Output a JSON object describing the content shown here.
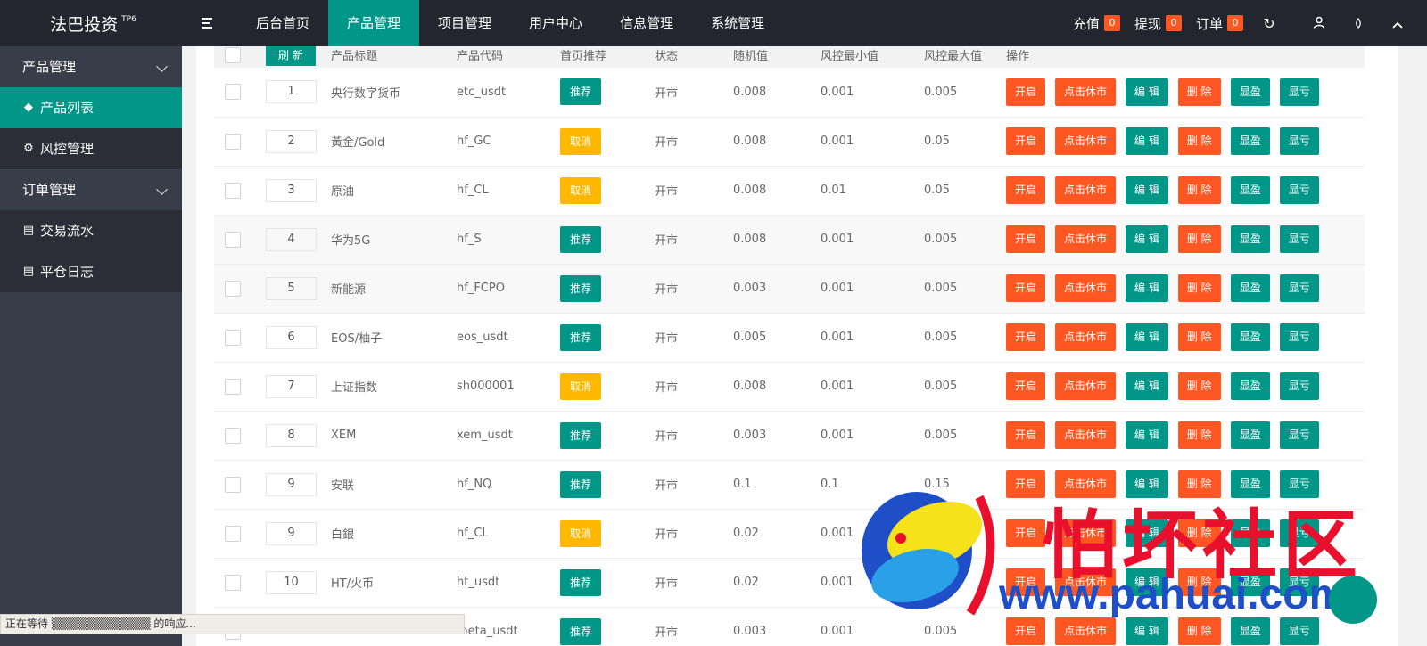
{
  "app": {
    "title": "法巴投资",
    "version": "TP6"
  },
  "topnav": [
    "后台首页",
    "产品管理",
    "项目管理",
    "用户中心",
    "信息管理",
    "系统管理"
  ],
  "header_right": {
    "recharge": {
      "label": "充值",
      "count": "0"
    },
    "withdraw": {
      "label": "提现",
      "count": "0"
    },
    "orders": {
      "label": "订单",
      "count": "0"
    }
  },
  "sidebar": {
    "group1": "产品管理",
    "item_product_list": "产品列表",
    "item_risk": "风控管理",
    "group2": "订单管理",
    "item_trade": "交易流水",
    "item_close_log": "平仓日志"
  },
  "table": {
    "refresh_label": "刷 新",
    "headers": [
      "产品标题",
      "产品代码",
      "首页推荐",
      "状态",
      "随机值",
      "风控最小值",
      "风控最大值",
      "操作"
    ],
    "ops": [
      "开启",
      "点击休市",
      "编 辑",
      "删 除",
      "显盈",
      "显亏"
    ],
    "rows": [
      {
        "sort": "1",
        "title": "央行数字货币",
        "code": "etc_usdt",
        "rec": "推荐",
        "status": "开市",
        "random": "0.008",
        "min": "0.001",
        "max": "0.005"
      },
      {
        "sort": "2",
        "title": "黃金/Gold",
        "code": "hf_GC",
        "rec": "取消",
        "status": "开市",
        "random": "0.008",
        "min": "0.001",
        "max": "0.05"
      },
      {
        "sort": "3",
        "title": "原油",
        "code": "hf_CL",
        "rec": "取消",
        "status": "开市",
        "random": "0.008",
        "min": "0.01",
        "max": "0.05"
      },
      {
        "sort": "4",
        "title": "华为5G",
        "code": "hf_S",
        "rec": "推荐",
        "status": "开市",
        "random": "0.008",
        "min": "0.001",
        "max": "0.005"
      },
      {
        "sort": "5",
        "title": "新能源",
        "code": "hf_FCPO",
        "rec": "推荐",
        "status": "开市",
        "random": "0.003",
        "min": "0.001",
        "max": "0.005"
      },
      {
        "sort": "6",
        "title": "EOS/柚子",
        "code": "eos_usdt",
        "rec": "推荐",
        "status": "开市",
        "random": "0.005",
        "min": "0.001",
        "max": "0.005"
      },
      {
        "sort": "7",
        "title": "上证指数",
        "code": "sh000001",
        "rec": "取消",
        "status": "开市",
        "random": "0.008",
        "min": "0.001",
        "max": "0.005"
      },
      {
        "sort": "8",
        "title": "XEM",
        "code": "xem_usdt",
        "rec": "推荐",
        "status": "开市",
        "random": "0.003",
        "min": "0.001",
        "max": "0.005"
      },
      {
        "sort": "9",
        "title": "安联",
        "code": "hf_NQ",
        "rec": "推荐",
        "status": "开市",
        "random": "0.1",
        "min": "0.1",
        "max": "0.15"
      },
      {
        "sort": "9",
        "title": "白銀",
        "code": "hf_CL",
        "rec": "取消",
        "status": "开市",
        "random": "0.02",
        "min": "0.001",
        "max": "0.005"
      },
      {
        "sort": "10",
        "title": "HT/火币",
        "code": "ht_usdt",
        "rec": "推荐",
        "status": "开市",
        "random": "0.02",
        "min": "0.001",
        "max": ""
      },
      {
        "sort": "",
        "title": "",
        "code": "meta_usdt",
        "rec": "推荐",
        "status": "开市",
        "random": "0.003",
        "min": "0.001",
        "max": "0.005"
      }
    ]
  },
  "watermark": {
    "text": "怕坏社区",
    "url": "www.pahuai.com"
  },
  "statusbar": "正在等待 ▒▒▒▒▒▒▒▒▒▒▒▒ 的响应..."
}
